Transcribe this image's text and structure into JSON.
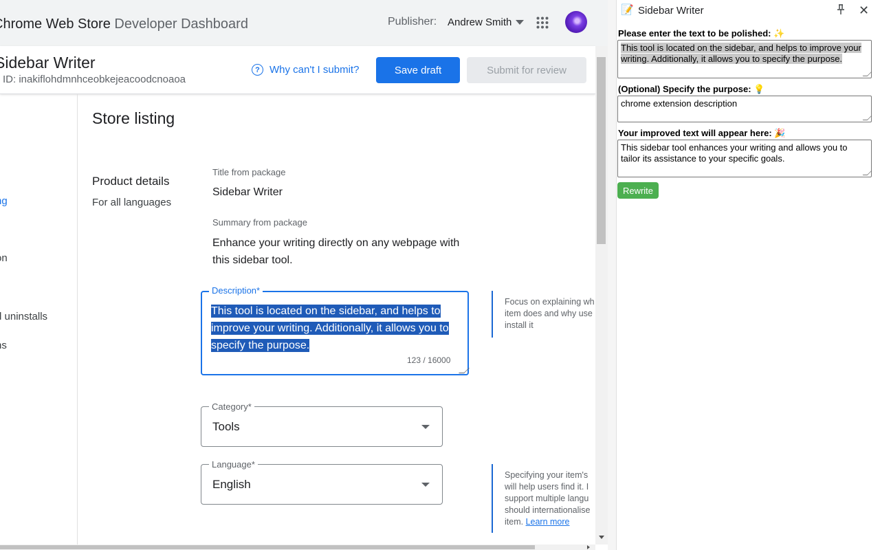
{
  "header": {
    "brand_main": "Chrome Web Store",
    "brand_sub": "Developer Dashboard",
    "publisher_label": "Publisher:",
    "publisher_name": "Andrew Smith"
  },
  "item": {
    "name": "Sidebar Writer",
    "id_text": "ID: inakiflohdmnhceobkejeacoodcnoaoa",
    "why_link": "Why can't I submit?",
    "save_draft": "Save draft",
    "submit_review": "Submit for review"
  },
  "nav": {
    "items": [
      "ng",
      "on",
      "d uninstalls",
      "ns"
    ]
  },
  "listing": {
    "section_title": "Store listing",
    "product_details_title": "Product details",
    "product_details_sub": "For all languages",
    "title_label": "Title from package",
    "title_value": "Sidebar Writer",
    "summary_label": "Summary from package",
    "summary_value": "Enhance your writing directly on any webpage with this sidebar tool.",
    "description_label": "Description*",
    "description_value": "This tool is located on the sidebar, and helps to improve your writing. Additionally, it allows you to specify the purpose.",
    "description_count": "123 / 16000",
    "description_help": [
      "Focus on explaining wh",
      "item does and why use",
      "install it"
    ],
    "category_label": "Category*",
    "category_value": "Tools",
    "language_label": "Language*",
    "language_value": "English",
    "language_help": [
      "Specifying your item's",
      "will help users find it. I",
      "support multiple langu",
      "should internationalise",
      "item. "
    ],
    "language_help_link": "Learn more"
  },
  "sidebar": {
    "title": "Sidebar Writer",
    "input_label": "Please enter the text to be polished: ✨",
    "input_value": "This tool is located on the sidebar, and helps to improve your writing. Additionally, it allows you to specify the purpose.",
    "purpose_label": "(Optional) Specify the purpose: 💡",
    "purpose_value": "chrome extension description",
    "output_label": "Your improved text will appear here: 🎉",
    "output_value": "This sidebar tool enhances your writing and allows you to tailor its assistance to your specific goals.",
    "rewrite_button": "Rewrite"
  },
  "colors": {
    "accent": "#1a73e8",
    "rewrite": "#4caf50",
    "selection": "#1f5bb8"
  }
}
